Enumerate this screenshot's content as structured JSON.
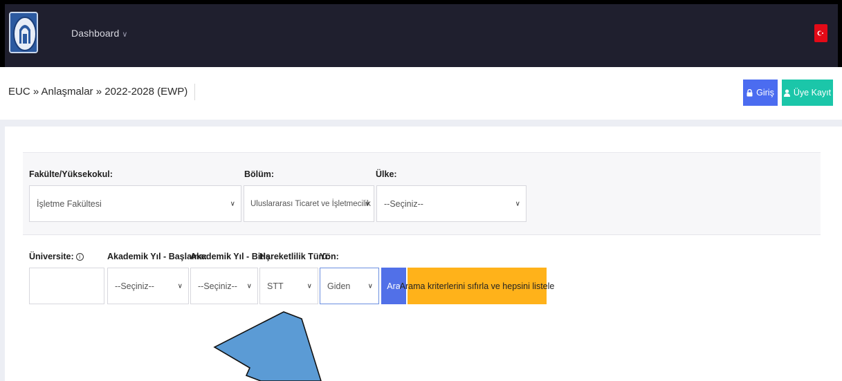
{
  "header": {
    "nav_dashboard": "Dashboard",
    "chevron": "∨",
    "flag_icon": "turkish-flag-icon"
  },
  "breadcrumb": "EUC » Anlaşmalar » 2022-2028 (EWP)",
  "auth": {
    "login_label": "Giriş",
    "register_label": "Üye Kayıt"
  },
  "filters": {
    "faculty_label": "Fakülte/Yüksekokul:",
    "faculty_value": "İşletme Fakültesi",
    "department_label": "Bölüm:",
    "department_value": "Uluslararası Ticaret ve İşletmecilik",
    "country_label": "Ülke:",
    "country_value": "--Seçiniz--",
    "university_label": "Üniversite:",
    "university_info": "i",
    "start_year_label": "Akademik Yıl - Başlama:",
    "start_year_value": "--Seçiniz--",
    "end_year_label": "Akademik Yıl - Bitiş:",
    "end_year_value": "--Seçiniz--",
    "mobility_label": "Hareketlilik Türü:",
    "mobility_value": "STT",
    "direction_label": "Yön:",
    "direction_value": "Giden",
    "search_label": "Ara",
    "reset_label": "Arama kriterlerini sıfırla ve hepsini listele"
  },
  "colors": {
    "header_bg": "#1f1f2e",
    "login_btn": "#4b6cf0",
    "register_btn": "#1bc6a9",
    "search_btn": "#5170e8",
    "reset_btn": "#ffb21a",
    "annotation_arrow": "#5b9bd5"
  }
}
